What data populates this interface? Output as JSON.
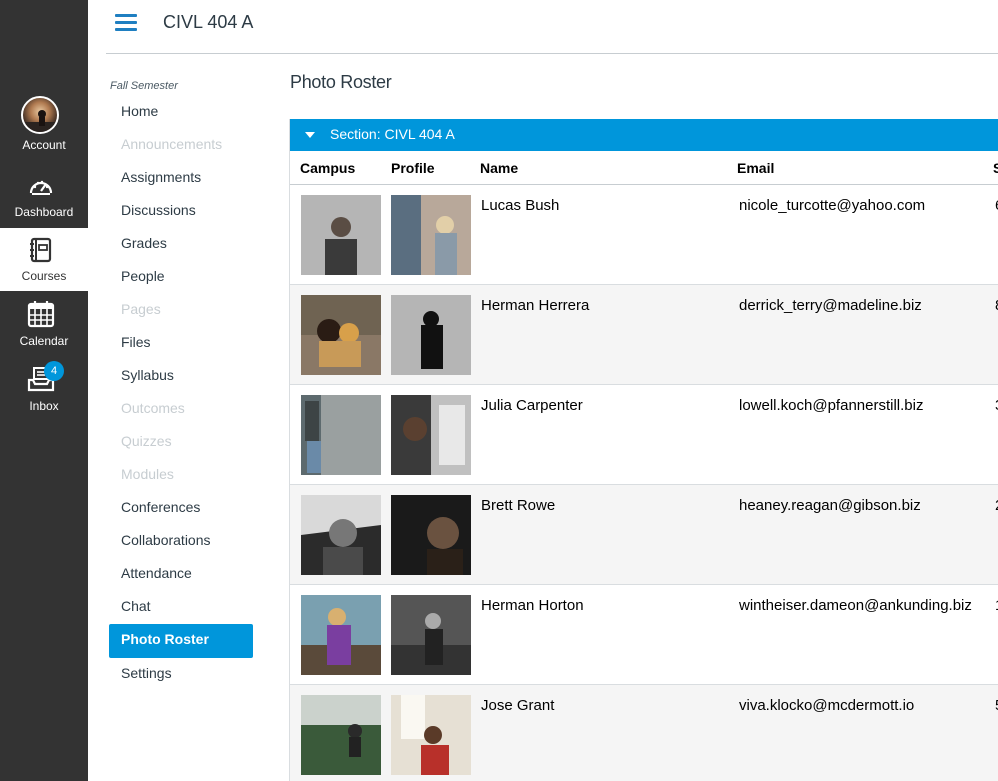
{
  "global_nav": {
    "account": "Account",
    "dashboard": "Dashboard",
    "courses": "Courses",
    "calendar": "Calendar",
    "inbox": "Inbox",
    "inbox_badge": "4",
    "accent": "#0096db",
    "background": "#333333"
  },
  "header": {
    "course_title": "CIVL 404 A"
  },
  "course_nav": {
    "term": "Fall Semester",
    "items": [
      {
        "label": "Home",
        "state": "normal"
      },
      {
        "label": "Announcements",
        "state": "disabled"
      },
      {
        "label": "Assignments",
        "state": "normal"
      },
      {
        "label": "Discussions",
        "state": "normal"
      },
      {
        "label": "Grades",
        "state": "normal"
      },
      {
        "label": "People",
        "state": "normal"
      },
      {
        "label": "Pages",
        "state": "disabled"
      },
      {
        "label": "Files",
        "state": "normal"
      },
      {
        "label": "Syllabus",
        "state": "normal"
      },
      {
        "label": "Outcomes",
        "state": "disabled"
      },
      {
        "label": "Quizzes",
        "state": "disabled"
      },
      {
        "label": "Modules",
        "state": "disabled"
      },
      {
        "label": "Conferences",
        "state": "normal"
      },
      {
        "label": "Collaborations",
        "state": "normal"
      },
      {
        "label": "Attendance",
        "state": "normal"
      },
      {
        "label": "Chat",
        "state": "normal"
      },
      {
        "label": "Photo Roster",
        "state": "active"
      },
      {
        "label": "Settings",
        "state": "normal"
      }
    ]
  },
  "main": {
    "page_title": "Photo Roster",
    "section_label": "Section: CIVL 404 A",
    "columns": {
      "campus": "Campus",
      "profile": "Profile",
      "name": "Name",
      "email": "Email",
      "extra": "S"
    },
    "rows": [
      {
        "name": "Lucas Bush",
        "email": "nicole_turcotte@yahoo.com",
        "extra": "6"
      },
      {
        "name": "Herman Herrera",
        "email": "derrick_terry@madeline.biz",
        "extra": "8"
      },
      {
        "name": "Julia Carpenter",
        "email": "lowell.koch@pfannerstill.biz",
        "extra": "3"
      },
      {
        "name": "Brett Rowe",
        "email": "heaney.reagan@gibson.biz",
        "extra": "2"
      },
      {
        "name": "Herman Horton",
        "email": "wintheiser.dameon@ankunding.biz",
        "extra": "1"
      },
      {
        "name": "Jose Grant",
        "email": "viva.klocko@mcdermott.io",
        "extra": "5"
      }
    ]
  }
}
